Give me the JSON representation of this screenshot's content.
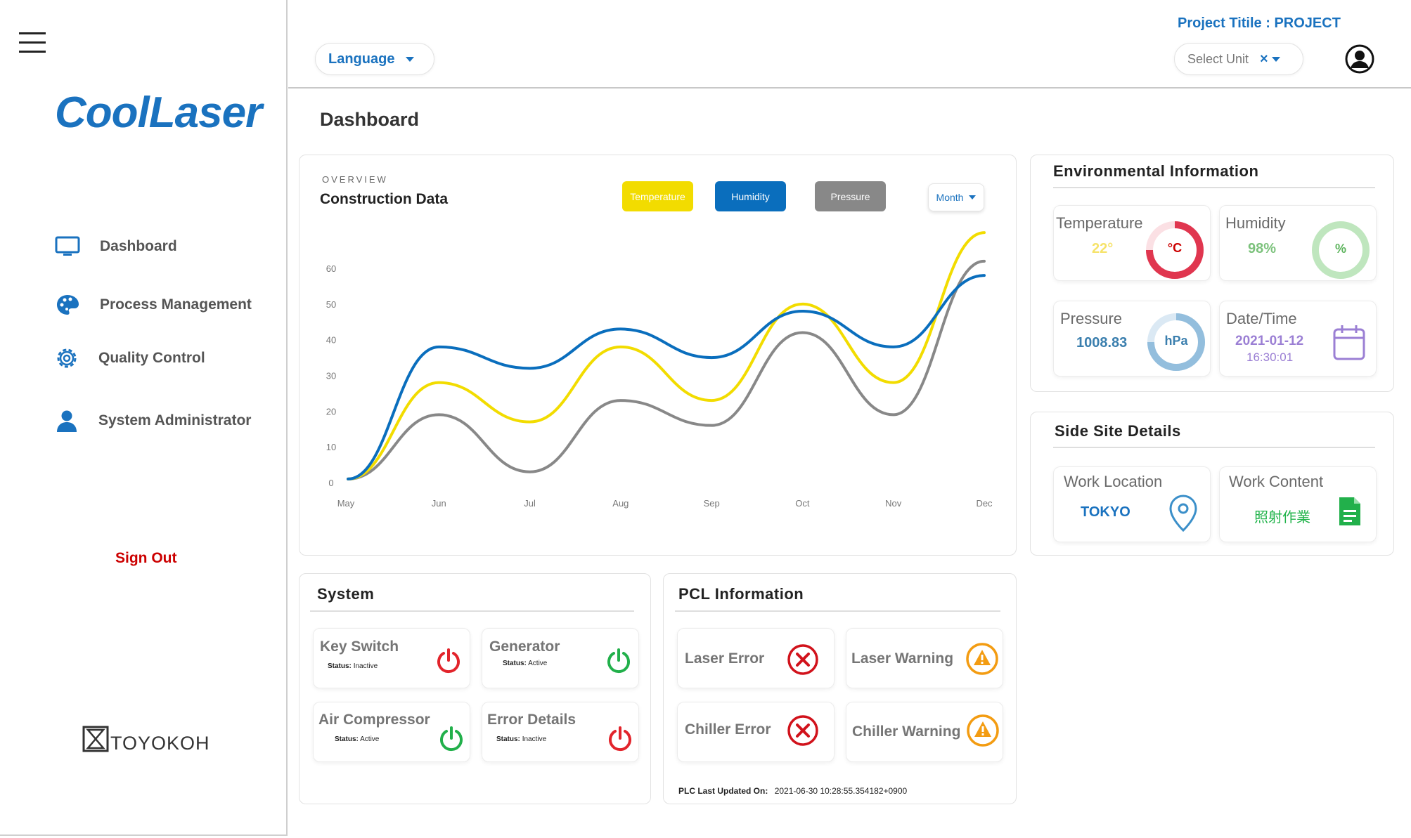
{
  "header": {
    "project_title": "Project Titile : PROJECT",
    "language_label": "Language",
    "select_unit_placeholder": "Select Unit",
    "clear_symbol": "×"
  },
  "sidebar": {
    "logo_text": "CoolLaser",
    "items": [
      {
        "label": "Dashboard",
        "icon": "monitor-icon"
      },
      {
        "label": "Process Management",
        "icon": "palette-icon"
      },
      {
        "label": "Quality Control",
        "icon": "gear-icon"
      },
      {
        "label": "System Administrator",
        "icon": "user-icon"
      }
    ],
    "sign_out": "Sign Out",
    "footer_logo": "TOYOKOH"
  },
  "page": {
    "title": "Dashboard"
  },
  "overview": {
    "eyebrow": "OVERVIEW",
    "title": "Construction Data",
    "buttons": {
      "temperature": "Temperature",
      "humidity": "Humidity",
      "pressure": "Pressure"
    },
    "period": "Month"
  },
  "colors": {
    "temperature": "#f2dc00",
    "humidity": "#0a6ebd",
    "pressure": "#888888",
    "brand": "#1a72bf",
    "sign_out": "#cc0000"
  },
  "chart_data": {
    "type": "line",
    "categories": [
      "May",
      "Jun",
      "Jul",
      "Aug",
      "Sep",
      "Oct",
      "Nov",
      "Dec"
    ],
    "ylim": [
      0,
      60
    ],
    "yticks": [
      0,
      10,
      20,
      30,
      40,
      50,
      60
    ],
    "series": [
      {
        "name": "Temperature",
        "values": [
          1,
          28,
          17,
          38,
          23,
          50,
          28,
          70
        ]
      },
      {
        "name": "Humidity",
        "values": [
          1,
          38,
          32,
          43,
          35,
          48,
          38,
          58
        ]
      },
      {
        "name": "Pressure",
        "values": [
          1,
          19,
          3,
          23,
          16,
          42,
          19,
          62
        ]
      }
    ]
  },
  "environment": {
    "title": "Environmental Information",
    "temperature": {
      "label": "Temperature",
      "value": "22°",
      "unit": "°C"
    },
    "humidity": {
      "label": "Humidity",
      "value": "98%",
      "unit": "%"
    },
    "pressure": {
      "label": "Pressure",
      "value": "1008.83",
      "unit": "hPa"
    },
    "datetime": {
      "label": "Date/Time",
      "date": "2021-01-12",
      "time": "16:30:01"
    }
  },
  "site": {
    "title": "Side Site Details",
    "location": {
      "label": "Work Location",
      "value": "TOKYO"
    },
    "content": {
      "label": "Work Content",
      "value": "照射作業"
    }
  },
  "system": {
    "title": "System",
    "status_prefix": "Status:",
    "items": [
      {
        "label": "Key Switch",
        "status": "Inactive"
      },
      {
        "label": "Generator",
        "status": "Active"
      },
      {
        "label": "Air Compressor",
        "status": "Active"
      },
      {
        "label": "Error Details",
        "status": "Inactive"
      }
    ]
  },
  "plc": {
    "title": "PCL Information",
    "laser_error": "Laser Error",
    "laser_warning": "Laser Warning",
    "chiller_error": "Chiller Error",
    "chiller_warning": "Chiller Warning",
    "updated_label": "PLC Last Updated On:",
    "updated_value": "2021-06-30 10:28:55.354182+0900"
  }
}
